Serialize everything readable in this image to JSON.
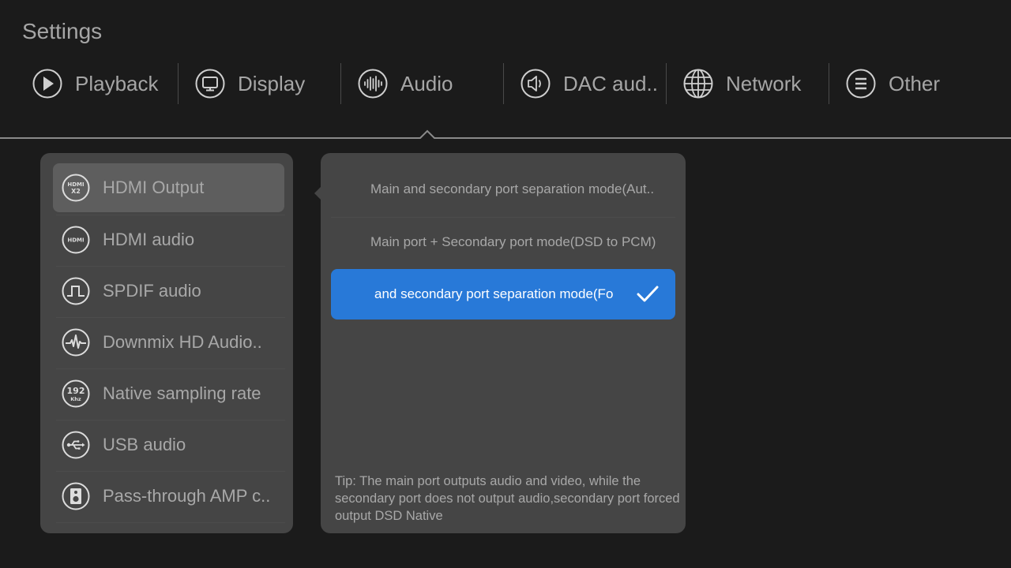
{
  "header": {
    "title": "Settings"
  },
  "tabs": [
    {
      "label": "Playback",
      "icon": "play-icon"
    },
    {
      "label": "Display",
      "icon": "monitor-icon"
    },
    {
      "label": "Audio",
      "icon": "audio-wave-icon",
      "active": true
    },
    {
      "label": "DAC aud..",
      "icon": "speaker-icon"
    },
    {
      "label": "Network",
      "icon": "globe-icon"
    },
    {
      "label": "Other",
      "icon": "menu-lines-icon"
    }
  ],
  "menu": {
    "items": [
      {
        "label": "HDMI Output",
        "icon": "hdmi-x2-icon",
        "icon_text": [
          "HDMI",
          "X2"
        ],
        "selected": true
      },
      {
        "label": "HDMI audio",
        "icon": "hdmi-icon",
        "icon_text": [
          "HDMI"
        ]
      },
      {
        "label": "SPDIF audio",
        "icon": "square-wave-icon"
      },
      {
        "label": "Downmix HD Audio..",
        "icon": "waveform-icon"
      },
      {
        "label": "Native sampling rate",
        "icon": "192khz-icon",
        "icon_text": [
          "192",
          "Khz"
        ]
      },
      {
        "label": "USB audio",
        "icon": "usb-icon"
      },
      {
        "label": "Pass-through AMP c..",
        "icon": "speaker-box-icon"
      }
    ]
  },
  "options": {
    "items": [
      {
        "label": "Main and secondary port separation mode(Aut.."
      },
      {
        "label": "Main port + Secondary port mode(DSD to PCM)"
      },
      {
        "label": "and secondary port separation mode(Fo",
        "selected": true
      }
    ],
    "tip": "Tip: The main port outputs audio and video, while the secondary port does not output audio,secondary port forced output DSD Native"
  },
  "colors": {
    "background": "#1b1b1b",
    "panel": "#454545",
    "selected_menu": "#5e5e5e",
    "accent": "#2879d8",
    "text": "#a8a8a8"
  }
}
